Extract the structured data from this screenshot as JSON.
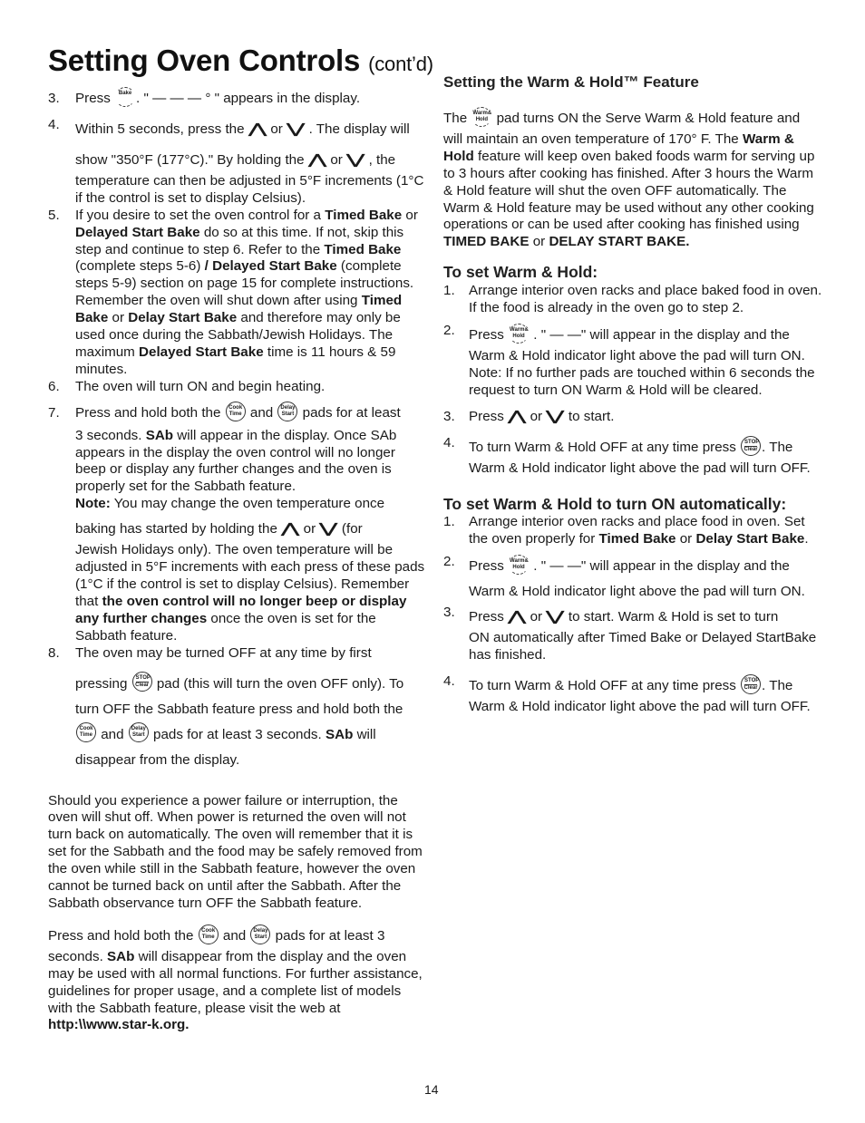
{
  "title": {
    "main": "Setting Oven Controls",
    "suffix": "(cont’d)"
  },
  "pads": {
    "bake": "Bake",
    "cook_time_top": "Cook",
    "cook_time_bottom": "Time",
    "delay_start_top": "Delay",
    "delay_start_bottom": "Start",
    "stop_top": "STOP",
    "stop_bottom": "Clear",
    "warm_hold_top": "Warm&",
    "warm_hold_bottom": "Hold",
    "up_arrow": "⋀",
    "down_arrow": "⋁"
  },
  "left": {
    "step3": {
      "num": "3.",
      "a": "Press ",
      "b": ". \" — — — ° \" appears in the display."
    },
    "step4": {
      "num": "4.",
      "a": "Within 5 seconds, press the ",
      "or": " or ",
      "b": " . The display will",
      "c": "show \"350°F (177°C).\" By holding the ",
      "d": " , the",
      "e": "temperature can then be adjusted in 5°F increments (1°C if the control is set to display Celsius)."
    },
    "step5": {
      "num": "5.",
      "t1": "If you desire to set the oven control for a ",
      "b1": "Timed Bake",
      "t2": " or ",
      "b2": "Delayed Start Bake",
      "t3": " do so at this time. If not, skip this step and continue to step 6. Refer to the ",
      "b3": "Timed Bake",
      "t4": " (complete steps 5-6) ",
      "b4": "/ Delayed Start Bake",
      "t5": " (complete steps 5-9) section on page 15 for complete instructions. Remember the oven will shut down after using ",
      "b5": "Timed Bake",
      "t6": " or ",
      "b6": "Delay Start Bake",
      "t7": " and therefore may only be used once during the Sabbath/Jewish Holidays. The maximum ",
      "b7": "Delayed Start Bake",
      "t8": " time is 11 hours & 59 minutes."
    },
    "step6": {
      "num": "6.",
      "text": "The oven will turn ON and begin heating."
    },
    "step7": {
      "num": "7.",
      "a": "Press and hold both the ",
      "and": " and ",
      "b": " pads for at least",
      "c": "3 seconds. ",
      "sab": "SAb",
      "d": " will appear in the display. Once SAb appears in the display the oven control will no longer beep or display any further changes and the oven is properly set for the Sabbath feature.",
      "note_label": "Note:",
      "note": " You may change the oven temperature once",
      "e": "baking has started by holding the ",
      "or": " or ",
      "f": " (for",
      "g": "Jewish Holidays only). The oven temperature will be adjusted in 5°F increments with each press of these pads (1°C if the control is set to display Celsius). Remember that ",
      "g_bold": "the oven control will no longer beep or display any further changes",
      "h": " once the oven is set for the Sabbath feature."
    },
    "step8": {
      "num": "8.",
      "a": "The oven may be turned OFF at any time by first",
      "b": "pressing ",
      "c": " pad (this will turn the oven OFF only). To",
      "d": "turn OFF the Sabbath feature press and hold both the",
      "and": " and ",
      "e": " pads for at least 3 seconds. ",
      "sab": "SAb",
      "f": " will",
      "g": "disappear from the display."
    },
    "power_failure": "Should you experience a power failure or interruption, the oven will shut off. When power is returned the oven will not turn back on automatically. The oven will remember that it is set for the Sabbath and the food may be safely removed from the oven while still in the Sabbath feature, however the oven cannot be turned back on until after the Sabbath. After the Sabbath observance turn OFF the Sabbath feature.",
    "final": {
      "a": "Press and hold both the ",
      "and": " and ",
      "b": " pads for at least 3",
      "c": "seconds. ",
      "sab": "SAb",
      "d": " will disappear from the display and the oven may be used with all normal functions. For further assistance, guidelines for proper usage, and a complete list of models with the Sabbath feature, please visit the web at",
      "url": "http:\\\\www.star-k.org."
    }
  },
  "right": {
    "heading": "Setting the Warm & Hold™ Feature",
    "intro": {
      "a": "The ",
      "b": " pad turns ON the Serve Warm & Hold feature and",
      "c": "will maintain an oven temperature of 170° F. The ",
      "c_bold": "Warm & Hold",
      "d": " feature will keep oven baked foods warm for serving up to 3 hours after cooking has finished. After 3 hours the Warm & Hold feature will shut the oven OFF automatically. The Warm & Hold feature may be used without any other cooking operations or can be used after cooking has finished using ",
      "d_bold1": "TIMED BAKE",
      "e": " or ",
      "d_bold2": "DELAY START BAKE."
    },
    "set_heading": "To set Warm & Hold:",
    "set_steps": {
      "s1": {
        "num": "1.",
        "text": "Arrange interior oven racks and place baked food in oven. If the food is already in the oven go to step 2."
      },
      "s2": {
        "num": "2.",
        "a": "Press ",
        "b": " .  \" — —\" will appear in the display and the",
        "c": "Warm & Hold indicator light above the pad will turn ON. Note: If no further pads are touched within 6 seconds the request to turn ON Warm & Hold will be cleared."
      },
      "s3": {
        "num": "3.",
        "a": "Press ",
        "or": " or ",
        "b": " to start."
      },
      "s4": {
        "num": "4.",
        "a": "To turn Warm & Hold OFF at any time press ",
        "b": ". The",
        "c": "Warm & Hold indicator light above the pad will turn OFF."
      }
    },
    "auto_heading": "To set Warm & Hold to turn ON automatically:",
    "auto_steps": {
      "s1": {
        "num": "1.",
        "a": "Arrange interior oven racks and place food in oven. Set the oven properly for ",
        "b1": "Timed Bake",
        "t": " or ",
        "b2": "Delay Start Bake",
        "end": "."
      },
      "s2": {
        "num": "2.",
        "a": "Press ",
        "b": " .  \" — —\" will appear in the display and the",
        "c": "Warm & Hold indicator light above the pad will turn ON."
      },
      "s3": {
        "num": "3.",
        "a": "Press ",
        "or": " or ",
        "b": " to start. Warm & Hold is set to turn",
        "c": "ON automatically after Timed Bake or Delayed StartBake has finished."
      },
      "s4": {
        "num": "4.",
        "a": "To turn Warm & Hold OFF at any time press ",
        "b": ". The",
        "c": "Warm & Hold indicator light above the pad will turn OFF."
      }
    }
  },
  "page_number": "14"
}
